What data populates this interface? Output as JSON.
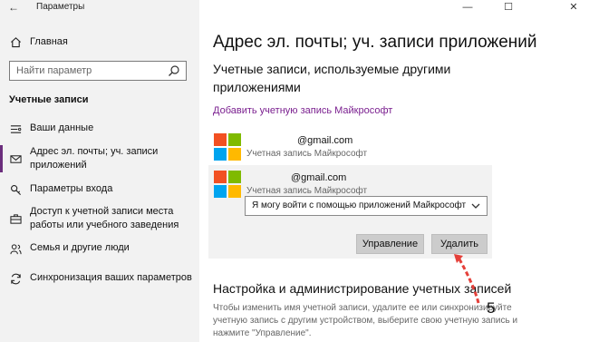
{
  "window": {
    "title": "Параметры",
    "back_glyph": "←",
    "controls": {
      "minimize": "—",
      "maximize": "☐",
      "close": "✕"
    }
  },
  "sidebar": {
    "home_label": "Главная",
    "search_placeholder": "Найти параметр",
    "section_header": "Учетные записи",
    "items": [
      {
        "label": "Ваши данные",
        "icon": "person-card-icon"
      },
      {
        "label": "Адрес эл. почты; уч. записи приложений",
        "icon": "mail-icon",
        "active": true
      },
      {
        "label": "Параметры входа",
        "icon": "key-icon"
      },
      {
        "label": "Доступ к учетной записи места работы или учебного заведения",
        "icon": "briefcase-icon"
      },
      {
        "label": "Семья и другие люди",
        "icon": "people-icon"
      },
      {
        "label": "Синхронизация ваших параметров",
        "icon": "sync-icon"
      }
    ]
  },
  "main": {
    "title": "Адрес эл. почты; уч. записи приложений",
    "subtitle": "Учетные записи, используемые другими приложениями",
    "add_link": "Добавить учетную запись Майкрософт",
    "accounts": [
      {
        "email": "@gmail.com",
        "type": "Учетная запись Майкрософт"
      },
      {
        "email": "@gmail.com",
        "type": "Учетная запись Майкрософт",
        "selected": true
      }
    ],
    "signin_dropdown": "Я могу войти с помощью приложений Майкрософт",
    "buttons": {
      "manage": "Управление",
      "delete": "Удалить"
    },
    "section2_title": "Настройка и администрирование учетных записей",
    "section2_desc": "Чтобы изменить имя учетной записи, удалите ее или синхронизируйте учетную запись с другим устройством, выберите свою учетную запись и нажмите \"Управление\"."
  },
  "annotation": {
    "number": "5",
    "color": "#e5403a"
  },
  "colors": {
    "accent": "#6b2e7d",
    "link": "#7a1f8f",
    "ms_red": "#f25022",
    "ms_green": "#7fba00",
    "ms_blue": "#00a4ef",
    "ms_yellow": "#ffb900"
  }
}
